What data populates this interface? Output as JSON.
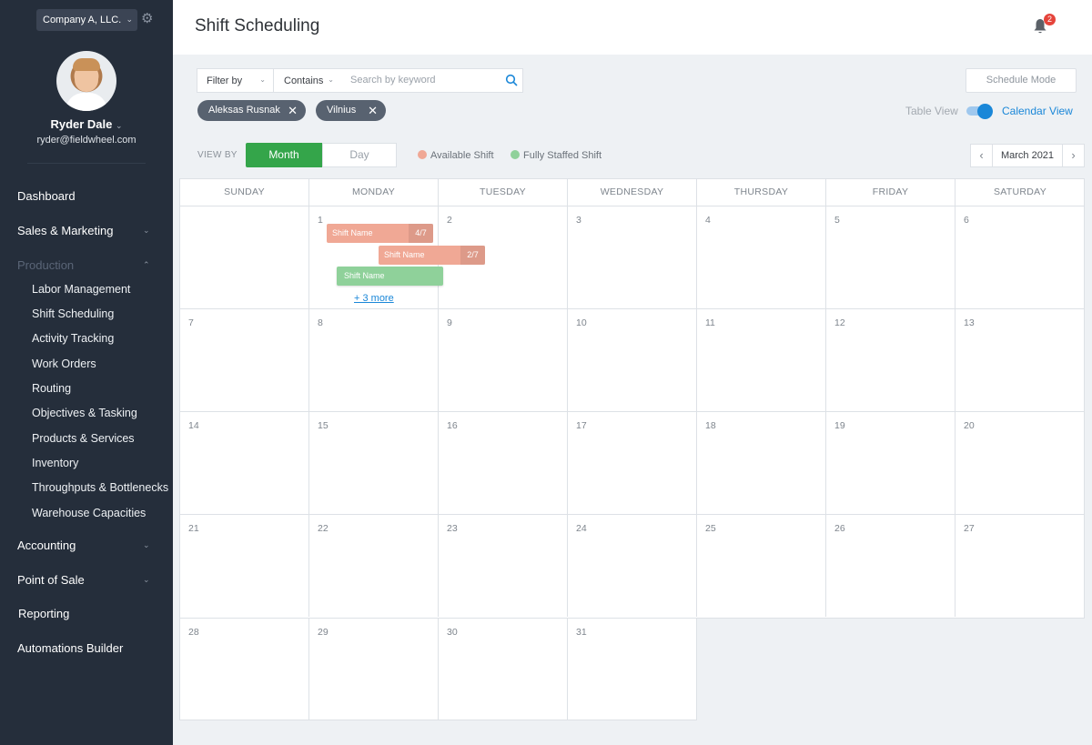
{
  "sidebar": {
    "company": "Company A, LLC.",
    "user_name": "Ryder Dale",
    "user_email": "ryder@fieldwheel.com",
    "nav": {
      "dashboard": "Dashboard",
      "sales": "Sales & Marketing",
      "production": "Production",
      "production_items": [
        "Labor Management",
        "Shift Scheduling",
        "Activity Tracking",
        "Work Orders",
        "Routing",
        "Objectives & Tasking",
        "Products & Services",
        "Inventory",
        "Throughputs & Bottlenecks",
        "Warehouse Capacities"
      ],
      "accounting": "Accounting",
      "pos": "Point of Sale",
      "reporting": "Reporting",
      "automations": "Automations Builder"
    }
  },
  "header": {
    "title": "Shift Scheduling",
    "notification_count": "2"
  },
  "filters": {
    "filter_by": "Filter by",
    "contains": "Contains",
    "search_placeholder": "Search by keyword",
    "chips": [
      "Aleksas Rusnak",
      "Vilnius"
    ],
    "schedule_mode": "Schedule Mode",
    "table_view": "Table View",
    "calendar_view": "Calendar View"
  },
  "viewbar": {
    "view_by": "VIEW BY",
    "month": "Month",
    "day": "Day",
    "legend_available": "Available Shift",
    "legend_full": "Fully Staffed Shift",
    "month_label": "March 2021"
  },
  "colors": {
    "available": "#f0a895",
    "full": "#8fd19a",
    "accent": "#1a87d8",
    "month_active": "#34a54a"
  },
  "calendar": {
    "weekdays": [
      "SUNDAY",
      "MONDAY",
      "TUESDAY",
      "WEDNESDAY",
      "THURSDAY",
      "FRIDAY",
      "SATURDAY"
    ],
    "days": [
      "",
      "1",
      "2",
      "3",
      "4",
      "5",
      "6",
      "7",
      "8",
      "9",
      "10",
      "11",
      "12",
      "13",
      "14",
      "15",
      "16",
      "17",
      "18",
      "19",
      "20",
      "21",
      "22",
      "23",
      "24",
      "25",
      "26",
      "27",
      "28",
      "29",
      "30",
      "31"
    ],
    "shifts": [
      {
        "name": "Shift Name",
        "count": "4/7"
      },
      {
        "name": "Shift Name",
        "count": "2/7"
      },
      {
        "name": "Shift Name",
        "count": ""
      }
    ],
    "more": "+ 3 more"
  }
}
